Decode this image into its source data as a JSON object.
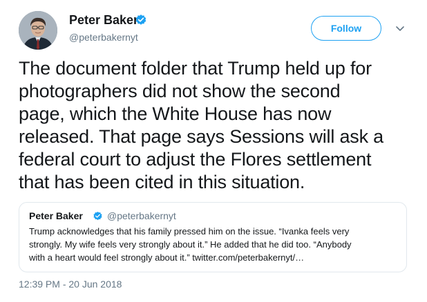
{
  "author": {
    "name": "Peter Baker",
    "handle": "@peterbakernyt",
    "avatar_icon": "person-portrait-icon",
    "verified_icon": "verified-badge-icon"
  },
  "header": {
    "follow_label": "Follow",
    "menu_icon": "chevron-down-icon"
  },
  "tweet": {
    "lines": [
      "The document folder that Trump held up for",
      "photographers did not show the second",
      "page, which the White House has now",
      "released. That page says Sessions will ask a",
      "federal court to adjust the Flores settlement",
      "that has been cited in this situation."
    ],
    "timestamp": "12:39 PM - 20 Jun 2018"
  },
  "quoted_tweet": {
    "name": "Peter Baker",
    "handle": "@peterbakernyt",
    "lines": [
      "Trump acknowledges that his family pressed him on the issue. “Ivanka feels very",
      "strongly. My wife feels very strongly about it.” He added that he did too. “Anybody",
      "with a heart would feel strongly about it.” twitter.com/peterbakernyt/…"
    ]
  },
  "colors": {
    "accent": "#1da1f2",
    "text": "#14171a",
    "secondary_text": "#657786",
    "border": "#e1e8ed"
  }
}
